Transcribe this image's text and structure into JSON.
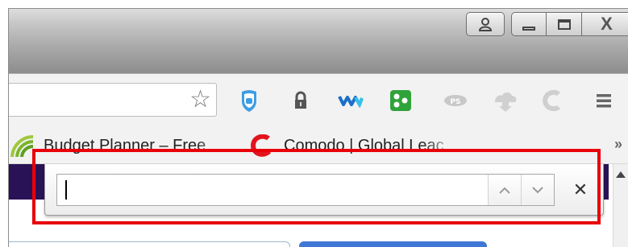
{
  "window": {
    "buttons": [
      {
        "name": "profile-button",
        "icon": "person-icon"
      },
      {
        "name": "minimize-button",
        "icon": "minimize-icon"
      },
      {
        "name": "maximize-button",
        "icon": "maximize-icon"
      },
      {
        "name": "close-window-button",
        "glyph": "X"
      }
    ]
  },
  "toolbar": {
    "star_glyph": "☆",
    "extensions": [
      "shield-icon",
      "lock-icon",
      "ww-icon",
      "green-dice-icon",
      "ps-icon",
      "cloud-download-icon",
      "comodo-c-icon",
      "menu-icon"
    ]
  },
  "bookmarks": {
    "items": [
      {
        "label": "Budget Planner – Free",
        "icon": "rainbow-icon"
      },
      {
        "label": "Comodo | Global Leac",
        "icon": "comodo-icon"
      }
    ],
    "overflow": "»"
  },
  "findbar": {
    "value": "",
    "placeholder": "",
    "prev_glyph": "▲",
    "next_glyph": "▼",
    "close_glyph": "✕"
  },
  "colors": {
    "highlight": "#e8000b",
    "page_header": "#2a1256",
    "page_button": "#3f77d6"
  }
}
